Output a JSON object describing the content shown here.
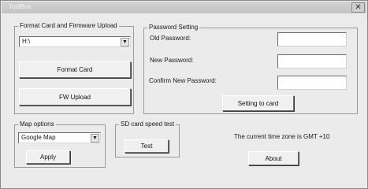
{
  "window": {
    "title": "ToolBox",
    "close_glyph": "✕"
  },
  "card_group": {
    "legend": "Format Card and Firmware Upload",
    "drive_value": "H:\\",
    "format_button": "Format Card",
    "fw_button": "FW Upload"
  },
  "password_group": {
    "legend": "Password Setting",
    "old_label": "Old Password:",
    "new_label": "New Password:",
    "confirm_label": "Confirm New Password:",
    "old_value": "",
    "new_value": "",
    "confirm_value": "",
    "set_button": "Setting to card"
  },
  "map_group": {
    "legend": "Map options",
    "map_value": "Google Map",
    "apply_button": "Apply"
  },
  "speed_group": {
    "legend": "SD card speed test",
    "test_button": "Test"
  },
  "timezone_text": "The current time zone is GMT +10",
  "about_button": "About",
  "icons": {
    "dropdown": "chevron-down-icon",
    "close": "close-icon"
  }
}
